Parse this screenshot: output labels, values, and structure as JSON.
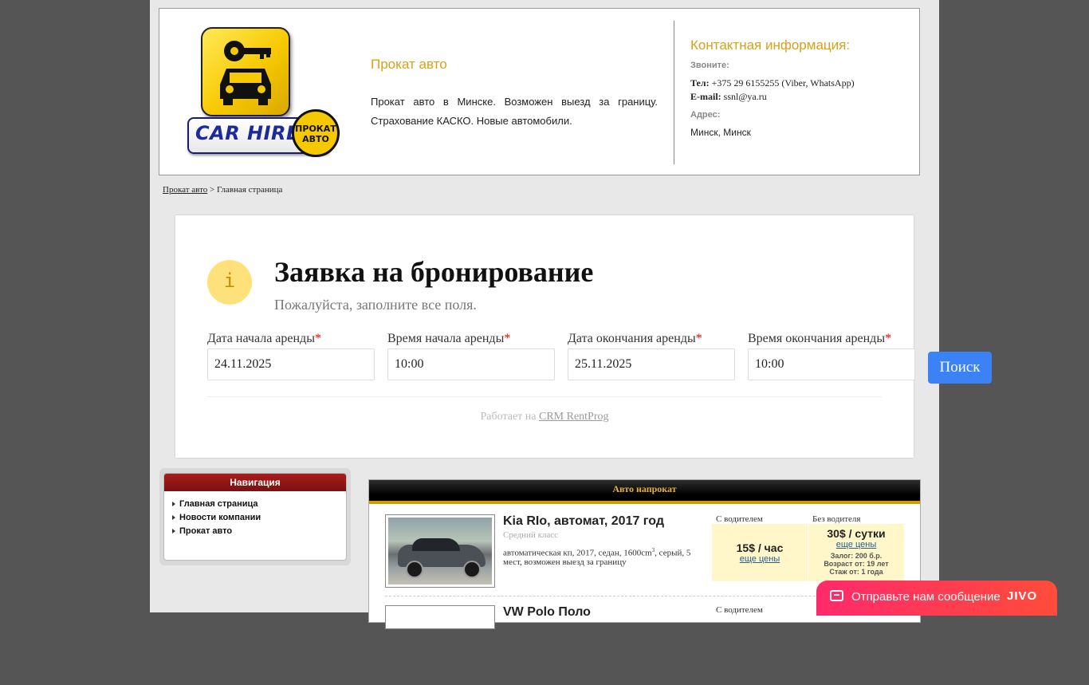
{
  "header": {
    "logo": {
      "text": "CAR HIRE",
      "badge_line1": "ПРОКАТ",
      "badge_line2": "АВТО"
    },
    "site_title": "Прокат авто",
    "site_description": "Прокат авто в Минске. Возможен выезд за границу. Страхование КАСКО. Новые автомобили.",
    "contacts": {
      "title": "Контактная информация:",
      "call_label": "Звоните:",
      "phone_label": "Тел:",
      "phone_value": "+375 29 6155255 (Viber, WhatsApp)",
      "email_label": "E-mail:",
      "email_value": "ssnl@ya.ru",
      "address_label": "Адрес:",
      "address_value": "Минск, Минск"
    }
  },
  "breadcrumb": {
    "home_link": "Прокат авто",
    "separator": " > ",
    "current": "Главная страница"
  },
  "booking": {
    "info_icon": "i",
    "title": "Заявка на бронирование",
    "subtitle": "Пожалуйста, заполните все поля.",
    "fields": [
      {
        "label": "Дата начала аренды",
        "value": "24.11.2025"
      },
      {
        "label": "Время начала аренды",
        "value": "10:00"
      },
      {
        "label": "Дата окончания аренды",
        "value": "25.11.2025"
      },
      {
        "label": "Время окончания аренды",
        "value": "10:00"
      }
    ],
    "required_mark": "*",
    "search_button": "Поиск",
    "powered_by_prefix": "Работает на ",
    "powered_by_link": "CRM RentProg"
  },
  "navigation": {
    "title": "Навигация",
    "items": [
      "Главная страница",
      "Новости компании",
      "Прокат авто"
    ]
  },
  "cars": {
    "title": "Авто напрокат",
    "with_driver_label": "С водителем",
    "without_driver_label": "Без водителя",
    "list": [
      {
        "name": "Kia RIo, автомат, 2017 год",
        "class": "Средний класс",
        "description_pre": "автоматическая кп, 2017, седан, 1600cm",
        "description_sup": "3",
        "description_post": ", серый, 5 мест, возможен выезд за границу",
        "with_driver_price": "15$ / час",
        "with_driver_more": "еще цены",
        "without_driver_price": "30$ / сутки",
        "without_driver_more": "еще цены",
        "deposit": "Залог: 200 б.р.",
        "age": "Возраст от: 19 лет",
        "experience": "Стаж от: 1 года"
      },
      {
        "name": "VW Polo Поло",
        "with_driver_label": "С водителем"
      }
    ]
  },
  "chat": {
    "text": "Отправьте нам сообщение",
    "brand": "JIVO"
  }
}
